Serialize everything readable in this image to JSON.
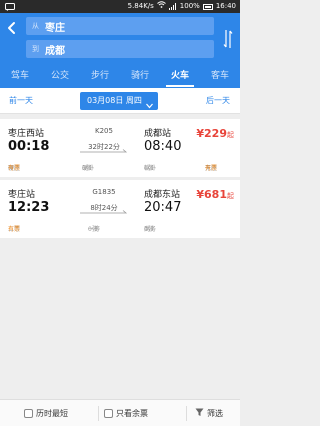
{
  "status_bar": {
    "speed": "5.84K/s",
    "battery_pct": "100%",
    "time": "16:40"
  },
  "header": {
    "from_prefix": "从",
    "from_city": "枣庄",
    "to_prefix": "到",
    "to_city": "成都",
    "tabs": [
      {
        "label": "驾车",
        "active": false
      },
      {
        "label": "公交",
        "active": false
      },
      {
        "label": "步行",
        "active": false
      },
      {
        "label": "骑行",
        "active": false
      },
      {
        "label": "火车",
        "active": true
      },
      {
        "label": "客车",
        "active": false
      }
    ]
  },
  "date_bar": {
    "prev_label": "前一天",
    "date_label": "03月08日 周四",
    "next_label": "后一天"
  },
  "trains": [
    {
      "dep_station": "枣庄西站",
      "dep_time": "00:18",
      "train_no": "K205",
      "duration": "32时22分",
      "arr_station": "成都站",
      "arr_time": "08:40",
      "price": "¥229",
      "price_suffix": "起",
      "seats": [
        {
          "label": "硬座",
          "status": "有票",
          "available": true
        },
        {
          "label": "硬卧",
          "status": "0张",
          "available": false
        },
        {
          "label": "软卧",
          "status": "0张",
          "available": false
        },
        {
          "label": "无座",
          "status": "有票",
          "available": true
        }
      ]
    },
    {
      "dep_station": "枣庄站",
      "dep_time": "12:23",
      "train_no": "G1835",
      "duration": "8时24分",
      "arr_station": "成都东站",
      "arr_time": "20:47",
      "price": "¥681",
      "price_suffix": "起",
      "seats": [
        {
          "label": "二等",
          "status": "有票",
          "available": true
        },
        {
          "label": "一等",
          "status": "0张",
          "available": false
        },
        {
          "label": "商务",
          "status": "0张",
          "available": false
        }
      ]
    }
  ],
  "bottom_bar": {
    "shortest_label": "历时最短",
    "remaining_label": "只看余票",
    "filter_label": "筛选"
  },
  "colors": {
    "brand_blue": "#2e86e8",
    "price_red": "#e8443a",
    "available_orange": "#f08a1c"
  }
}
